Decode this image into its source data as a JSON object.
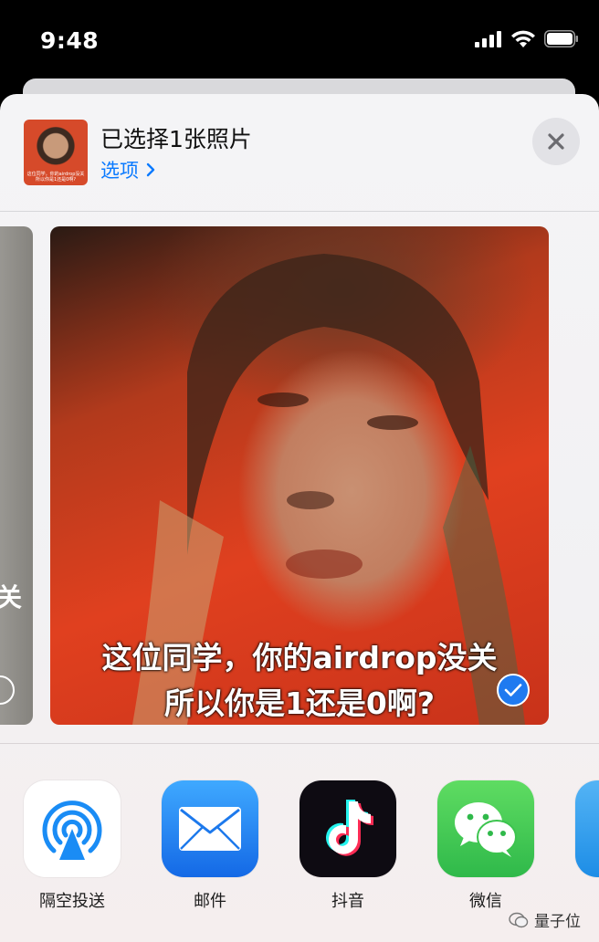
{
  "status_bar": {
    "time": "9:48",
    "icons": [
      "signal-icon",
      "wifi-icon",
      "battery-icon"
    ]
  },
  "share_sheet": {
    "title": "已选择1张照片",
    "options_label": "选项",
    "close_icon": "close-icon",
    "thumbnail_caption": "这位同学，你的airdrop没关 所以你是1还是0啊?"
  },
  "photos": {
    "left_partial_text": "关",
    "main_caption_line1": "这位同学，你的airdrop没关",
    "main_caption_line2": "所以你是1还是0啊?",
    "selected": true
  },
  "apps": [
    {
      "label": "隔空投送",
      "icon": "airdrop-icon"
    },
    {
      "label": "邮件",
      "icon": "mail-icon"
    },
    {
      "label": "抖音",
      "icon": "tiktok-icon"
    },
    {
      "label": "微信",
      "icon": "wechat-icon"
    }
  ],
  "watermark": "量子位",
  "colors": {
    "accent": "#0a7aff",
    "sheet_bg": "#f4f4f6",
    "check_blue": "#1f7af0"
  }
}
